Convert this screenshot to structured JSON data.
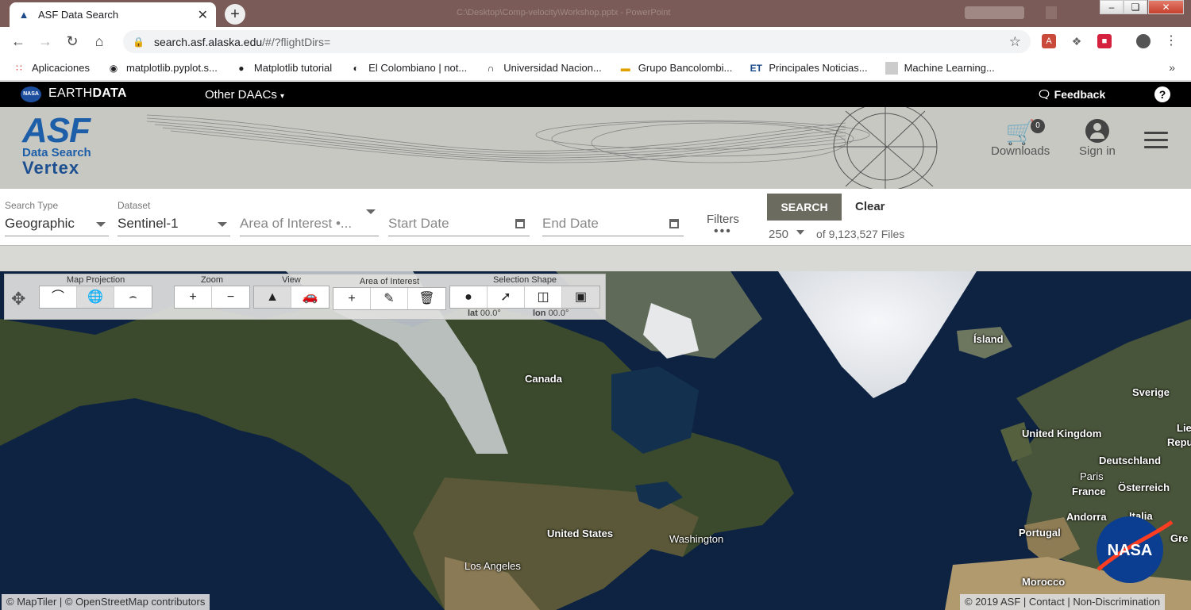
{
  "browser": {
    "tab_title": "ASF Data Search",
    "window_title_blurred": "C:\\Desktop\\Comp-velocity\\Workshop.pptx - PowerPoint",
    "url_host": "search.asf.alaska.edu",
    "url_path": "/#/?flightDirs=",
    "bookmarks": [
      {
        "label": "Aplicaciones",
        "icon": "apps-grid-icon"
      },
      {
        "label": "matplotlib.pyplot.s...",
        "icon": "matplotlib-icon"
      },
      {
        "label": "Matplotlib tutorial",
        "icon": "github-icon"
      },
      {
        "label": "El Colombiano | not...",
        "icon": "elcolombiano-icon"
      },
      {
        "label": "Universidad Nacion...",
        "icon": "unal-icon"
      },
      {
        "label": "Grupo Bancolombi...",
        "icon": "bancolombia-icon"
      },
      {
        "label": "Principales Noticias...",
        "icon": "et-icon"
      },
      {
        "label": "Machine Learning...",
        "icon": "ml-icon"
      }
    ]
  },
  "earthdata": {
    "badge": "NASA",
    "logo_light": "EARTH",
    "logo_bold": "DATA",
    "other_daacs": "Other DAACs",
    "feedback": "Feedback",
    "help": "?"
  },
  "header": {
    "asf": "ASF",
    "data_search": "Data Search",
    "vertex": "Vertex",
    "downloads_label": "Downloads",
    "downloads_count": "0",
    "signin_label": "Sign in"
  },
  "search": {
    "search_type_label": "Search Type",
    "search_type_value": "Geographic",
    "dataset_label": "Dataset",
    "dataset_value": "Sentinel-1",
    "aoi_placeholder": "Area of Interest •...",
    "start_date_placeholder": "Start Date",
    "end_date_placeholder": "End Date",
    "filters_label": "Filters",
    "filters_dots": "•••",
    "search_button": "SEARCH",
    "clear_button": "Clear",
    "max_results": "250",
    "files_count": "of 9,123,527 Files"
  },
  "toolbar": {
    "map_projection": "Map Projection",
    "zoom": "Zoom",
    "view": "View",
    "area_of_interest": "Area of Interest",
    "selection_shape": "Selection Shape",
    "lat_label": "lat",
    "lat_value": "00.0°",
    "lon_label": "lon",
    "lon_value": "00.0°"
  },
  "map_labels": {
    "canada": "Canada",
    "island": "Ísland",
    "sverige": "Sverige",
    "uk": "United Kingdom",
    "deutschland": "Deutschland",
    "repu": "Repu",
    "lie": "Lie",
    "paris": "Paris",
    "osterreich": "Österreich",
    "france": "France",
    "italia": "Italia",
    "andorra": "Andorra",
    "portugal": "Portugal",
    "gre": "Gre",
    "us": "United States",
    "washington": "Washington",
    "los_angeles": "Los Angeles",
    "morocco": "Morocco"
  },
  "footer": {
    "attribution": "© MapTiler | © OpenStreetMap contributors",
    "copyright": "© 2019 ASF",
    "contact": "Contact",
    "nondiscrimination": "Non-Discrimination",
    "nasa_logo": "NASA"
  },
  "colors": {
    "tabstrip": "#7a5b58",
    "asf_blue": "#1d5ea8",
    "header_gray": "#c8c8c3",
    "search_button": "#6b6b5f",
    "ocean": "#0e2342"
  }
}
